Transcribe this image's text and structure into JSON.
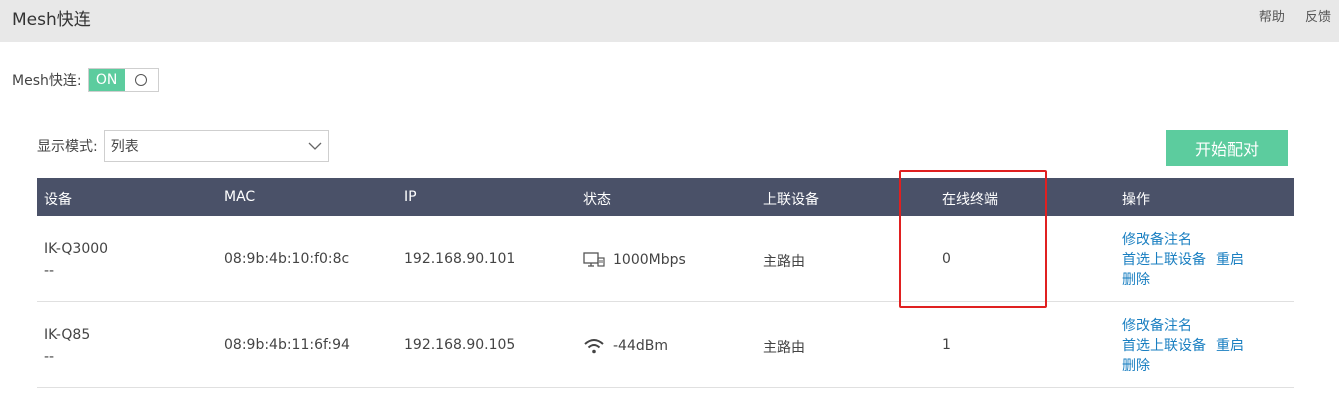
{
  "header": {
    "title": "Mesh快连",
    "help_label": "帮助",
    "feedback_label": "反馈"
  },
  "mesh": {
    "label": "Mesh快连:",
    "toggle_on_label": "ON"
  },
  "display_mode": {
    "label": "显示模式:",
    "selected": "列表"
  },
  "pair_button_label": "开始配对",
  "table": {
    "columns": [
      "设备",
      "MAC",
      "IP",
      "状态",
      "上联设备",
      "在线终端",
      "操作"
    ],
    "rows": [
      {
        "name": "IK-Q3000",
        "remark": "--",
        "mac": "08:9b:4b:10:f0:8c",
        "ip": "192.168.90.101",
        "status_icon": "ethernet-icon",
        "status": "1000Mbps",
        "uplink": "主路由",
        "online_clients": "0",
        "actions": {
          "rename": "修改备注名",
          "prefer_uplink": "首选上联设备",
          "reboot": "重启",
          "delete": "删除"
        }
      },
      {
        "name": "IK-Q85",
        "remark": "--",
        "mac": "08:9b:4b:11:6f:94",
        "ip": "192.168.90.105",
        "status_icon": "wifi-icon",
        "status": "-44dBm",
        "uplink": "主路由",
        "online_clients": "1",
        "actions": {
          "rename": "修改备注名",
          "prefer_uplink": "首选上联设备",
          "reboot": "重启",
          "delete": "删除"
        }
      }
    ]
  },
  "colors": {
    "accent_green": "#5ccc9e",
    "table_header": "#4a5168",
    "link_blue": "#1a7fc1",
    "highlight_red": "#e02020"
  }
}
